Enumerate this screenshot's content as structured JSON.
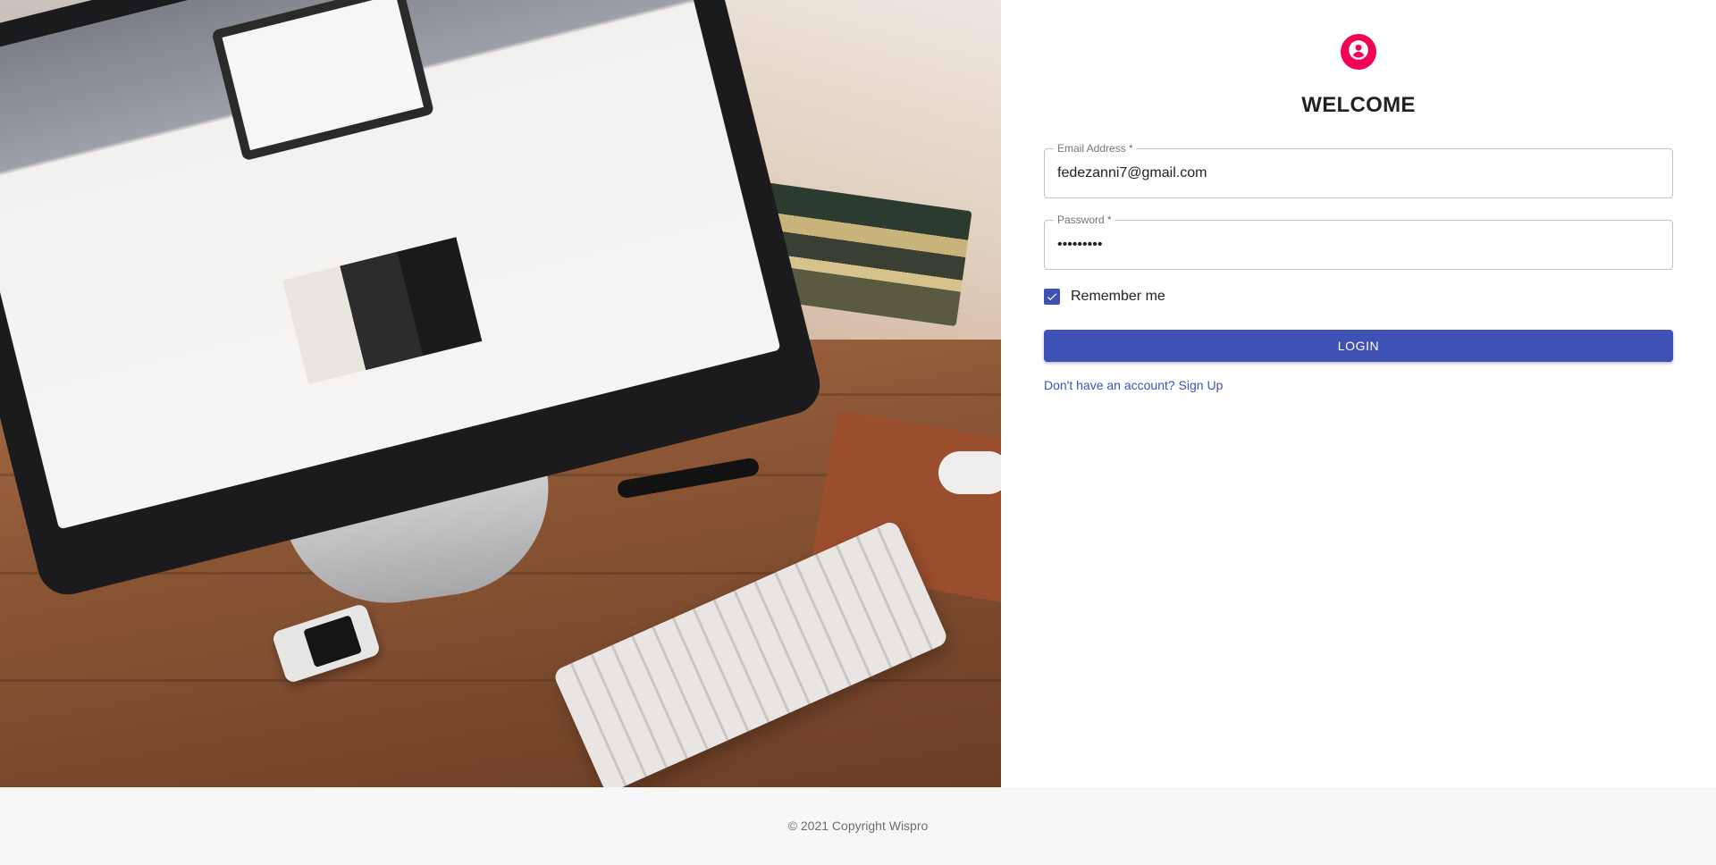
{
  "login": {
    "title": "WELCOME",
    "avatar_icon": "person-icon",
    "accent_color": "#f50057",
    "primary_color": "#3f51b5",
    "email": {
      "label": "Email Address *",
      "value": "fedezanni7@gmail.com"
    },
    "password": {
      "label": "Password *",
      "value": "•••••••••"
    },
    "remember": {
      "label": "Remember me",
      "checked": true
    },
    "login_button": "LOGIN",
    "signup_link": "Don't have an account? Sign Up"
  },
  "footer": {
    "copyright": "© 2021 Copyright Wispro"
  }
}
